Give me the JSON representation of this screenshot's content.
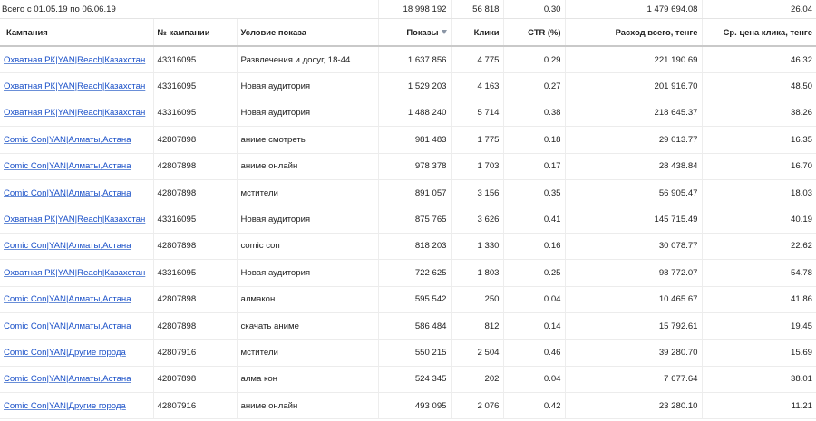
{
  "totals": {
    "period_label": "Всего с 01.05.19 по 06.06.19",
    "shows": "18 998 192",
    "clicks": "56 818",
    "ctr": "0.30",
    "spend": "1 479 694.08",
    "cpc": "26.04"
  },
  "columns": {
    "campaign": "Кампания",
    "campaign_id": "№ кампании",
    "condition": "Условие показа",
    "shows": "Показы",
    "clicks": "Клики",
    "ctr": "CTR (%)",
    "spend": "Расход всего, тенге",
    "cpc": "Ср. цена клика, тенге"
  },
  "sort": {
    "column": "shows",
    "direction": "desc",
    "icon": "sort-down-triangle-icon"
  },
  "colors": {
    "link": "#1a50c8",
    "sort_arrow": "#8b96a6",
    "text": "#222222",
    "border": "#ececec"
  },
  "rows": [
    {
      "campaign": "Охватная РК|YAN|Reach|Казахстан",
      "id": "43316095",
      "condition": "Развлечения и досуг, 18-44",
      "shows": "1 637 856",
      "clicks": "4 775",
      "ctr": "0.29",
      "spend": "221 190.69",
      "cpc": "46.32"
    },
    {
      "campaign": "Охватная РК|YAN|Reach|Казахстан",
      "id": "43316095",
      "condition": "Новая аудитория",
      "shows": "1 529 203",
      "clicks": "4 163",
      "ctr": "0.27",
      "spend": "201 916.70",
      "cpc": "48.50"
    },
    {
      "campaign": "Охватная РК|YAN|Reach|Казахстан",
      "id": "43316095",
      "condition": "Новая аудитория",
      "shows": "1 488 240",
      "clicks": "5 714",
      "ctr": "0.38",
      "spend": "218 645.37",
      "cpc": "38.26"
    },
    {
      "campaign": "Comic Con|YAN|Алматы,Астана",
      "id": "42807898",
      "condition": "аниме смотреть",
      "shows": "981 483",
      "clicks": "1 775",
      "ctr": "0.18",
      "spend": "29 013.77",
      "cpc": "16.35"
    },
    {
      "campaign": "Comic Con|YAN|Алматы,Астана",
      "id": "42807898",
      "condition": "аниме онлайн",
      "shows": "978 378",
      "clicks": "1 703",
      "ctr": "0.17",
      "spend": "28 438.84",
      "cpc": "16.70"
    },
    {
      "campaign": "Comic Con|YAN|Алматы,Астана",
      "id": "42807898",
      "condition": "мстители",
      "shows": "891 057",
      "clicks": "3 156",
      "ctr": "0.35",
      "spend": "56 905.47",
      "cpc": "18.03"
    },
    {
      "campaign": "Охватная РК|YAN|Reach|Казахстан",
      "id": "43316095",
      "condition": "Новая аудитория",
      "shows": "875 765",
      "clicks": "3 626",
      "ctr": "0.41",
      "spend": "145 715.49",
      "cpc": "40.19"
    },
    {
      "campaign": "Comic Con|YAN|Алматы,Астана",
      "id": "42807898",
      "condition": "comic con",
      "shows": "818 203",
      "clicks": "1 330",
      "ctr": "0.16",
      "spend": "30 078.77",
      "cpc": "22.62"
    },
    {
      "campaign": "Охватная РК|YAN|Reach|Казахстан",
      "id": "43316095",
      "condition": "Новая аудитория",
      "shows": "722 625",
      "clicks": "1 803",
      "ctr": "0.25",
      "spend": "98 772.07",
      "cpc": "54.78"
    },
    {
      "campaign": "Comic Con|YAN|Алматы,Астана",
      "id": "42807898",
      "condition": "алмакон",
      "shows": "595 542",
      "clicks": "250",
      "ctr": "0.04",
      "spend": "10 465.67",
      "cpc": "41.86"
    },
    {
      "campaign": "Comic Con|YAN|Алматы,Астана",
      "id": "42807898",
      "condition": "скачать аниме",
      "shows": "586 484",
      "clicks": "812",
      "ctr": "0.14",
      "spend": "15 792.61",
      "cpc": "19.45"
    },
    {
      "campaign": "Comic Con|YAN|Другие города",
      "id": "42807916",
      "condition": "мстители",
      "shows": "550 215",
      "clicks": "2 504",
      "ctr": "0.46",
      "spend": "39 280.70",
      "cpc": "15.69"
    },
    {
      "campaign": "Comic Con|YAN|Алматы,Астана",
      "id": "42807898",
      "condition": "алма кон",
      "shows": "524 345",
      "clicks": "202",
      "ctr": "0.04",
      "spend": "7 677.64",
      "cpc": "38.01"
    },
    {
      "campaign": "Comic Con|YAN|Другие города",
      "id": "42807916",
      "condition": "аниме онлайн",
      "shows": "493 095",
      "clicks": "2 076",
      "ctr": "0.42",
      "spend": "23 280.10",
      "cpc": "11.21"
    }
  ]
}
